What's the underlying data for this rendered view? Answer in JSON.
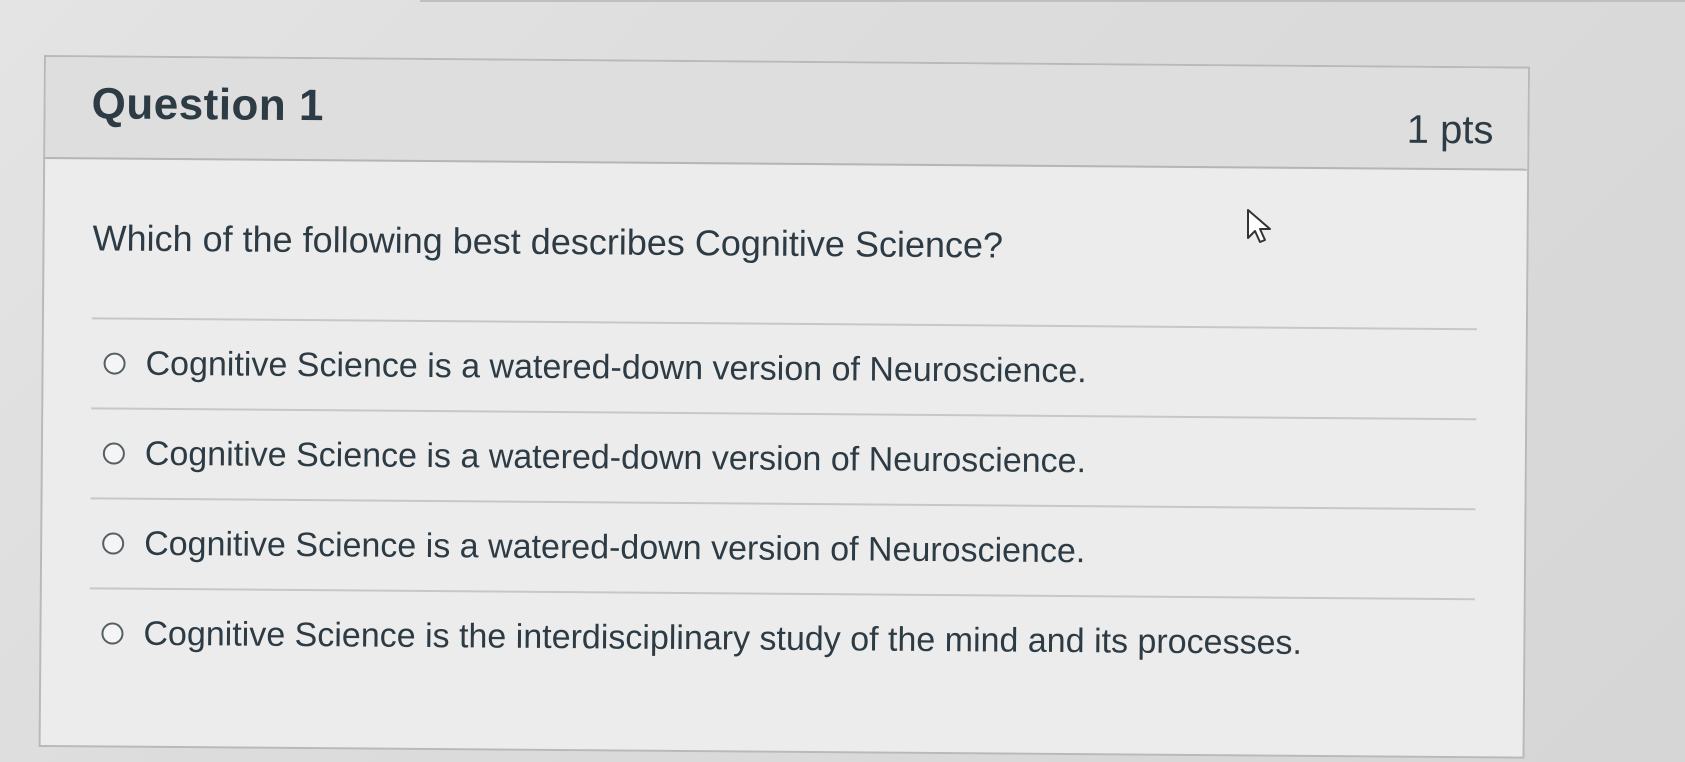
{
  "question": {
    "title": "Question 1",
    "points": "1 pts",
    "text": "Which of the following best describes Cognitive Science?",
    "answers": [
      {
        "label": "Cognitive Science is a watered-down version of Neuroscience.",
        "selected": false
      },
      {
        "label": "Cognitive Science is a watered-down version of Neuroscience.",
        "selected": false
      },
      {
        "label": "Cognitive Science is a watered-down version of Neuroscience.",
        "selected": false
      },
      {
        "label": "Cognitive Science is the interdisciplinary study of the mind and its processes.",
        "selected": false
      }
    ]
  },
  "icons": {
    "cursor": "mouse-pointer-icon",
    "radio": "radio-button-icon"
  },
  "colors": {
    "text": "#2d3b45",
    "header_bg": "#dedede",
    "card_bg": "#ececec",
    "border": "#b9b9b9"
  }
}
